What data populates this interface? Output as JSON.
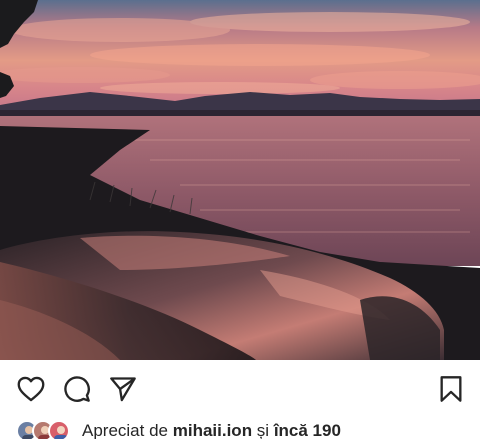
{
  "post": {
    "image_alt": "sunset-over-lake-with-car-hood-photo"
  },
  "actions": {
    "like_icon": "heart-icon",
    "comment_icon": "comment-icon",
    "share_icon": "send-icon",
    "save_icon": "bookmark-icon"
  },
  "likes": {
    "prefix": "Apreciat de ",
    "user": "mihaii.ion",
    "connector": " și ",
    "more": "încă 190"
  },
  "colors": {
    "icon": "#262626",
    "text": "#262626"
  }
}
